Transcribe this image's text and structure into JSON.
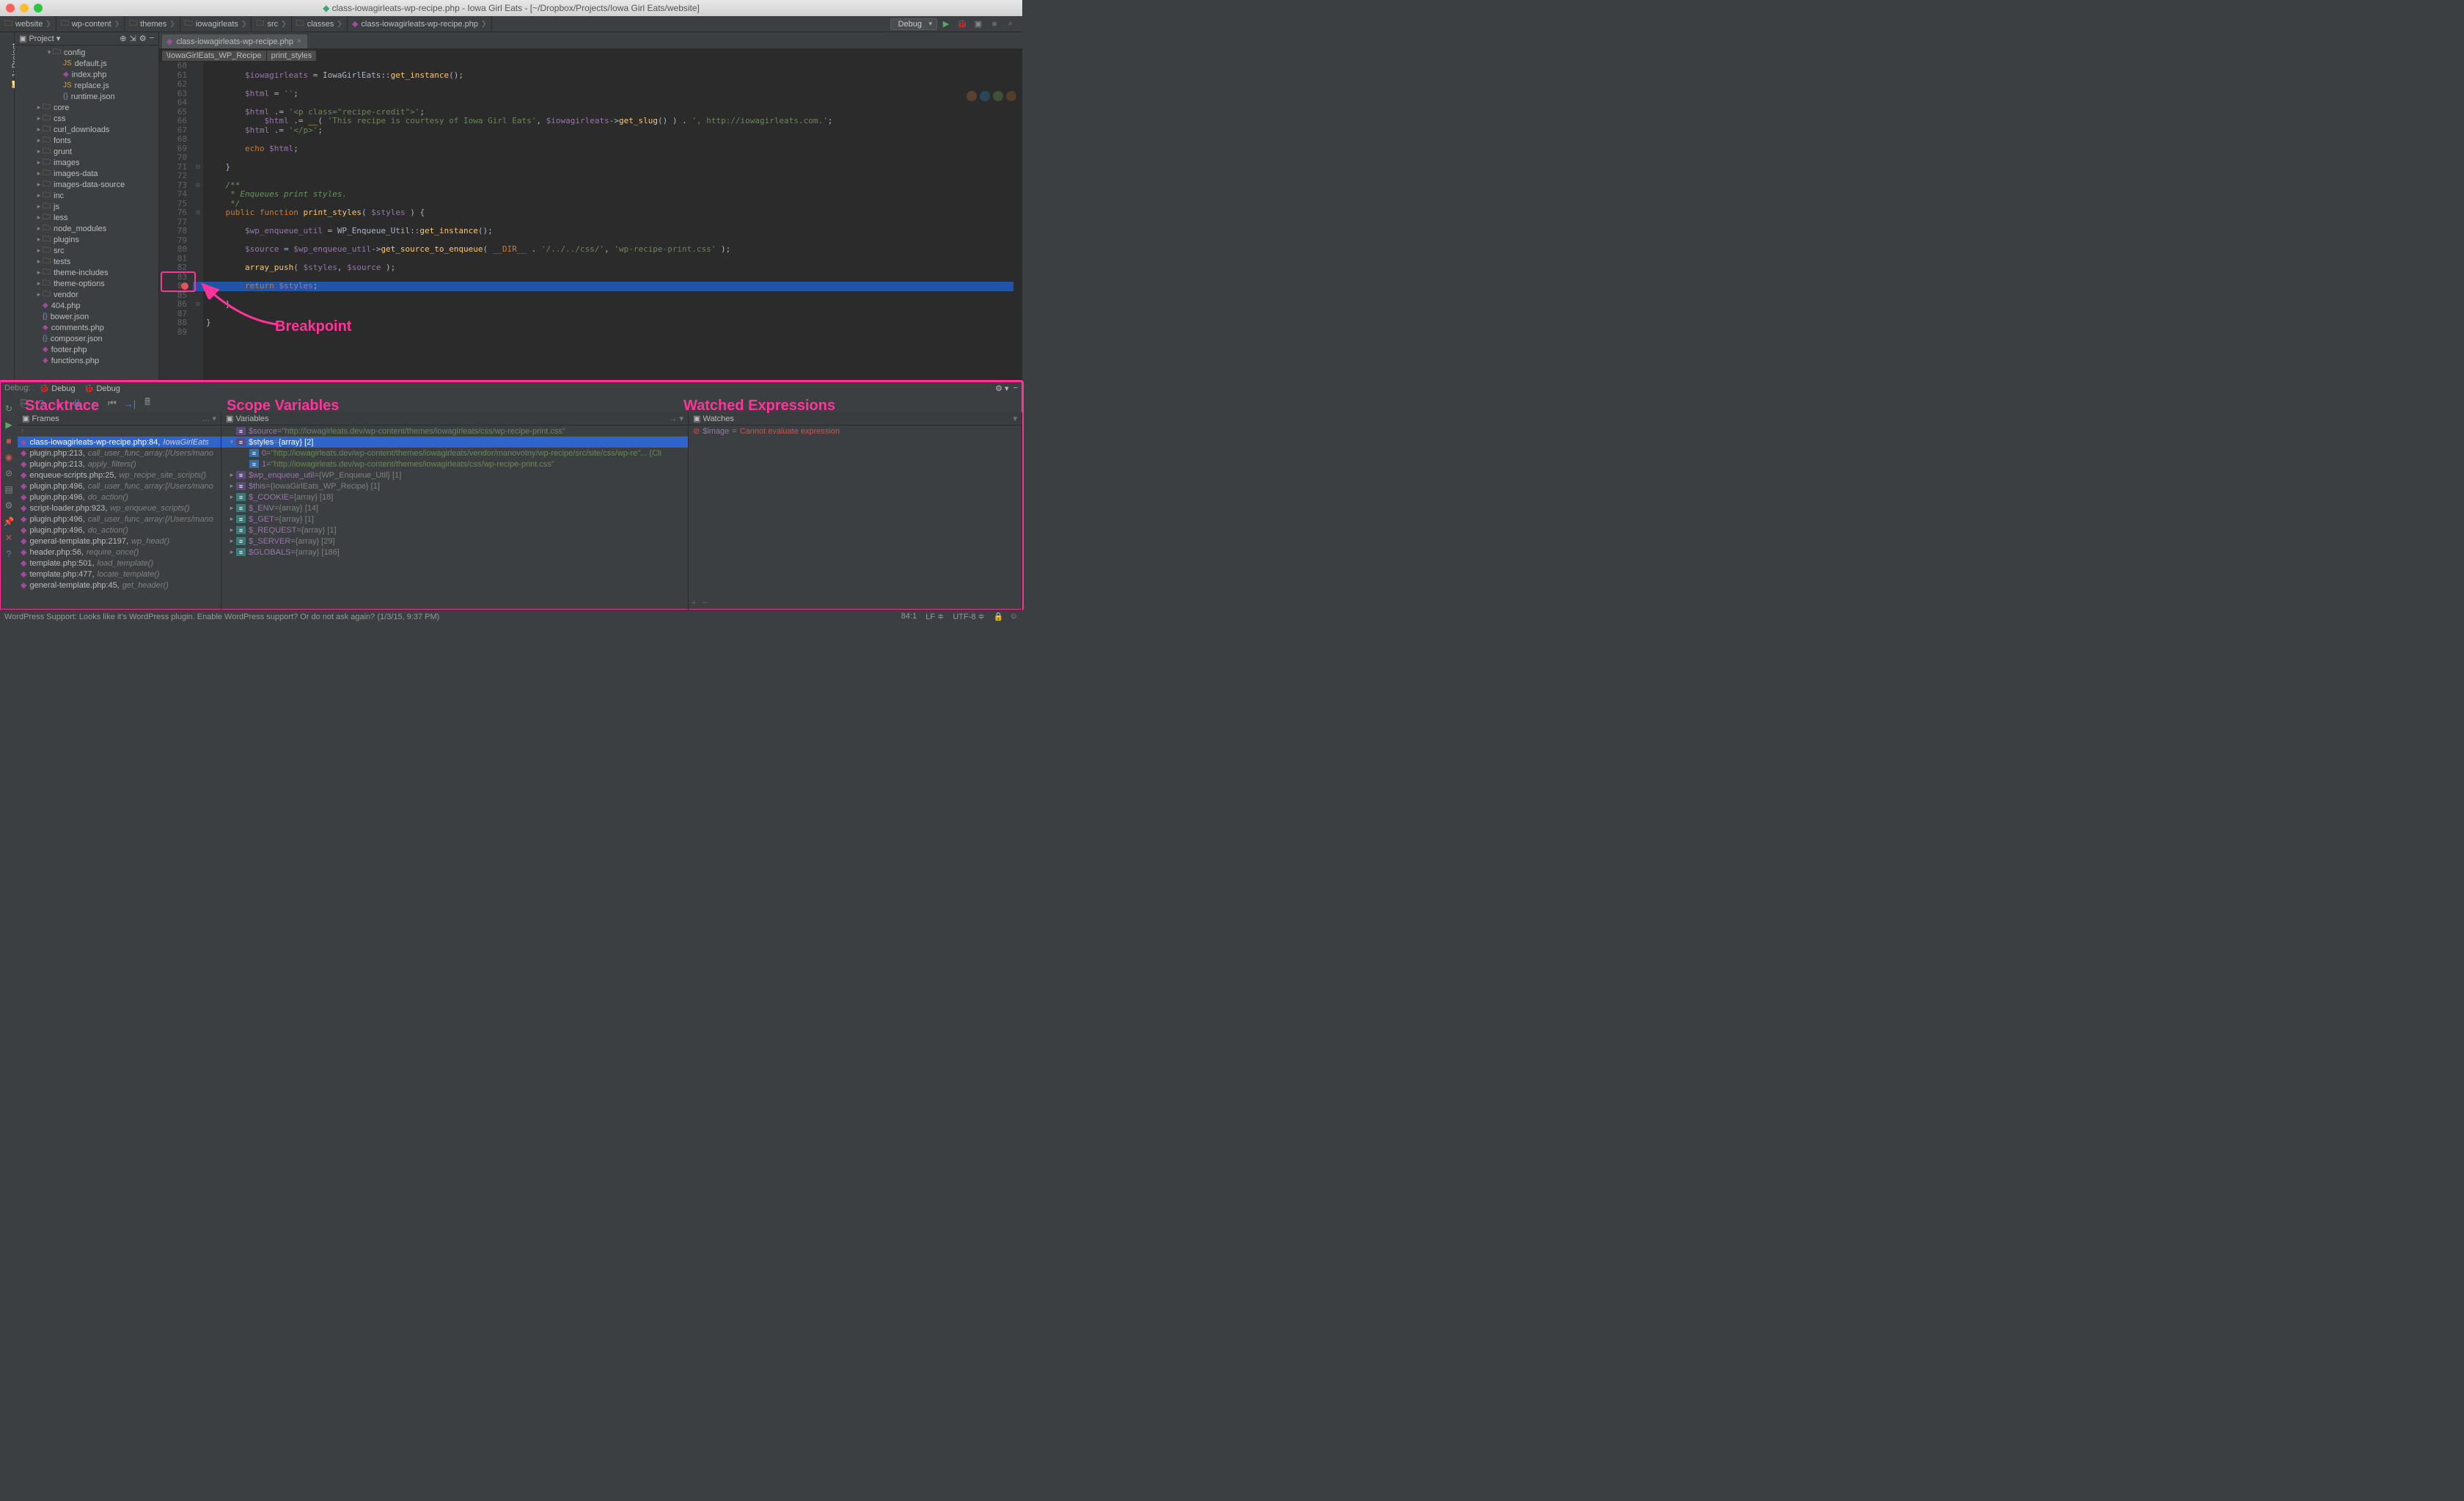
{
  "title": {
    "filename": "class-iowagirleats-wp-recipe.php",
    "project": "Iowa Girl Eats",
    "path": "[~/Dropbox/Projects/Iowa Girl Eats/website]"
  },
  "breadcrumbs": [
    "website",
    "wp-content",
    "themes",
    "iowagirleats",
    "src",
    "classes",
    "class-iowagirleats-wp-recipe.php"
  ],
  "toolbar": {
    "config": "Debug"
  },
  "sidebar": {
    "title": "Project",
    "tree": [
      {
        "depth": 3,
        "kind": "folder",
        "arrow": "▾",
        "label": "config"
      },
      {
        "depth": 4,
        "kind": "js",
        "label": "default.js"
      },
      {
        "depth": 4,
        "kind": "php",
        "label": "index.php"
      },
      {
        "depth": 4,
        "kind": "js",
        "label": "replace.js"
      },
      {
        "depth": 4,
        "kind": "json",
        "label": "runtime.json"
      },
      {
        "depth": 2,
        "kind": "folder",
        "arrow": "▸",
        "label": "core"
      },
      {
        "depth": 2,
        "kind": "folder",
        "arrow": "▸",
        "label": "css"
      },
      {
        "depth": 2,
        "kind": "folder",
        "arrow": "▸",
        "label": "curl_downloads"
      },
      {
        "depth": 2,
        "kind": "folder",
        "arrow": "▸",
        "label": "fonts"
      },
      {
        "depth": 2,
        "kind": "folder",
        "arrow": "▸",
        "label": "grunt"
      },
      {
        "depth": 2,
        "kind": "folder",
        "arrow": "▸",
        "label": "images"
      },
      {
        "depth": 2,
        "kind": "folder",
        "arrow": "▸",
        "label": "images-data"
      },
      {
        "depth": 2,
        "kind": "folder",
        "arrow": "▸",
        "label": "images-data-source"
      },
      {
        "depth": 2,
        "kind": "folder",
        "arrow": "▸",
        "label": "inc"
      },
      {
        "depth": 2,
        "kind": "folder",
        "arrow": "▸",
        "label": "js"
      },
      {
        "depth": 2,
        "kind": "folder",
        "arrow": "▸",
        "label": "less"
      },
      {
        "depth": 2,
        "kind": "folder",
        "arrow": "▸",
        "label": "node_modules"
      },
      {
        "depth": 2,
        "kind": "folder",
        "arrow": "▸",
        "label": "plugins"
      },
      {
        "depth": 2,
        "kind": "folder",
        "arrow": "▸",
        "label": "src"
      },
      {
        "depth": 2,
        "kind": "folder",
        "arrow": "▸",
        "label": "tests"
      },
      {
        "depth": 2,
        "kind": "folder",
        "arrow": "▸",
        "label": "theme-includes"
      },
      {
        "depth": 2,
        "kind": "folder",
        "arrow": "▸",
        "label": "theme-options"
      },
      {
        "depth": 2,
        "kind": "folder",
        "arrow": "▸",
        "label": "vendor"
      },
      {
        "depth": 2,
        "kind": "php",
        "label": "404.php"
      },
      {
        "depth": 2,
        "kind": "json",
        "label": "bower.json"
      },
      {
        "depth": 2,
        "kind": "php",
        "label": "comments.php"
      },
      {
        "depth": 2,
        "kind": "json",
        "label": "composer.json"
      },
      {
        "depth": 2,
        "kind": "php",
        "label": "footer.php"
      },
      {
        "depth": 2,
        "kind": "php",
        "label": "functions.php"
      }
    ]
  },
  "editor": {
    "tab": "class-iowagirleats-wp-recipe.php",
    "crumb": [
      "\\IowaGirlEats_WP_Recipe",
      "print_styles"
    ],
    "first_line": 60,
    "breakpoint_line": 84,
    "lines": [
      "",
      "        $iowagirleats = IowaGirlEats::get_instance();",
      "",
      "        $html = '';",
      "",
      "        $html .= '<p class=\"recipe-credit\">';",
      "            $html .= __( 'This recipe is courtesy of Iowa Girl Eats', $iowagirleats->get_slug() ) . ', http://iowagirleats.com.';",
      "        $html .= '</p>';",
      "",
      "        echo $html;",
      "",
      "    }",
      "",
      "    /**",
      "     * Enqueues print styles.",
      "     */",
      "    public function print_styles( $styles ) {",
      "",
      "        $wp_enqueue_util = WP_Enqueue_Util::get_instance();",
      "",
      "        $source = $wp_enqueue_util->get_source_to_enqueue( __DIR__ . '/../../css/', 'wp-recipe-print.css' );",
      "",
      "        array_push( $styles, $source );",
      "",
      "        return $styles;",
      "",
      "    }",
      "",
      "}",
      ""
    ]
  },
  "annotation_breakpoint": "Breakpoint",
  "debug": {
    "tab_label": "Debug:",
    "sessions": [
      "Debug",
      "Debug"
    ],
    "frames_label": "Frames",
    "vars_label": "Variables",
    "watches_label": "Watches",
    "frames": [
      {
        "file": "class-iowagirleats-wp-recipe.php",
        "line": 84,
        "fn": "IowaGirlEats",
        "sel": true
      },
      {
        "file": "plugin.php",
        "line": 213,
        "fn": "call_user_func_array:{/Users/mano"
      },
      {
        "file": "plugin.php",
        "line": 213,
        "fn": "apply_filters()"
      },
      {
        "file": "enqueue-scripts.php",
        "line": 25,
        "fn": "wp_recipe_site_scripts()"
      },
      {
        "file": "plugin.php",
        "line": 496,
        "fn": "call_user_func_array:{/Users/mano"
      },
      {
        "file": "plugin.php",
        "line": 496,
        "fn": "do_action()"
      },
      {
        "file": "script-loader.php",
        "line": 923,
        "fn": "wp_enqueue_scripts()"
      },
      {
        "file": "plugin.php",
        "line": 496,
        "fn": "call_user_func_array:{/Users/mano"
      },
      {
        "file": "plugin.php",
        "line": 496,
        "fn": "do_action()"
      },
      {
        "file": "general-template.php",
        "line": 2197,
        "fn": "wp_head()"
      },
      {
        "file": "header.php",
        "line": 56,
        "fn": "require_once()"
      },
      {
        "file": "template.php",
        "line": 501,
        "fn": "load_template()"
      },
      {
        "file": "template.php",
        "line": 477,
        "fn": "locate_template()"
      },
      {
        "file": "general-template.php",
        "line": 45,
        "fn": "get_header()"
      }
    ],
    "variables": [
      {
        "depth": 0,
        "exp": "",
        "vcls": "purple",
        "name": "$source",
        "val": "\"http://iowagirleats.dev/wp-content/themes/iowagirleats/css/wp-recipe-print.css\"",
        "valcls": "var-val"
      },
      {
        "depth": 0,
        "exp": "▾",
        "vcls": "purple",
        "name": "$styles",
        "val": "{array} [2]",
        "valcls": "var-meta",
        "sel": true
      },
      {
        "depth": 1,
        "exp": "",
        "vcls": "blue",
        "name": "0",
        "val": "\"http://iowagirleats.dev/wp-content/themes/iowagirleats/vendor/manovotny/wp-recipe/src/site/css/wp-re\"... (Cli",
        "valcls": "var-val"
      },
      {
        "depth": 1,
        "exp": "",
        "vcls": "blue",
        "name": "1",
        "val": "\"http://iowagirleats.dev/wp-content/themes/iowagirleats/css/wp-recipe-print.css\"",
        "valcls": "var-val"
      },
      {
        "depth": 0,
        "exp": "▸",
        "vcls": "purple",
        "name": "$wp_enqueue_util",
        "val": "{WP_Enqueue_Util} [1]",
        "valcls": "var-meta"
      },
      {
        "depth": 0,
        "exp": "▸",
        "vcls": "purple",
        "name": "$this",
        "val": "{IowaGirlEats_WP_Recipe} [1]",
        "valcls": "var-meta"
      },
      {
        "depth": 0,
        "exp": "▸",
        "vcls": "teal",
        "name": "$_COOKIE",
        "val": "{array} [18]",
        "valcls": "var-meta"
      },
      {
        "depth": 0,
        "exp": "▸",
        "vcls": "teal",
        "name": "$_ENV",
        "val": "{array} [14]",
        "valcls": "var-meta"
      },
      {
        "depth": 0,
        "exp": "▸",
        "vcls": "teal",
        "name": "$_GET",
        "val": "{array} [1]",
        "valcls": "var-meta"
      },
      {
        "depth": 0,
        "exp": "▸",
        "vcls": "teal",
        "name": "$_REQUEST",
        "val": "{array} [1]",
        "valcls": "var-meta"
      },
      {
        "depth": 0,
        "exp": "▸",
        "vcls": "teal",
        "name": "$_SERVER",
        "val": "{array} [29]",
        "valcls": "var-meta"
      },
      {
        "depth": 0,
        "exp": "▸",
        "vcls": "teal",
        "name": "$GLOBALS",
        "val": "{array} [186]",
        "valcls": "var-meta"
      }
    ],
    "watches": [
      {
        "name": "$image",
        "val": "Cannot evaluate expression"
      }
    ],
    "annot_stacktrace": "Stacktrace",
    "annot_scope": "Scope Variables",
    "annot_watched": "Watched Expressions"
  },
  "statusbar": {
    "msg": "WordPress Support: Looks like it's WordPress plugin. Enable WordPress support? Or do not ask again? (1/3/15, 9:37 PM)",
    "pos": "84:1",
    "le": "LF",
    "enc": "UTF-8"
  }
}
